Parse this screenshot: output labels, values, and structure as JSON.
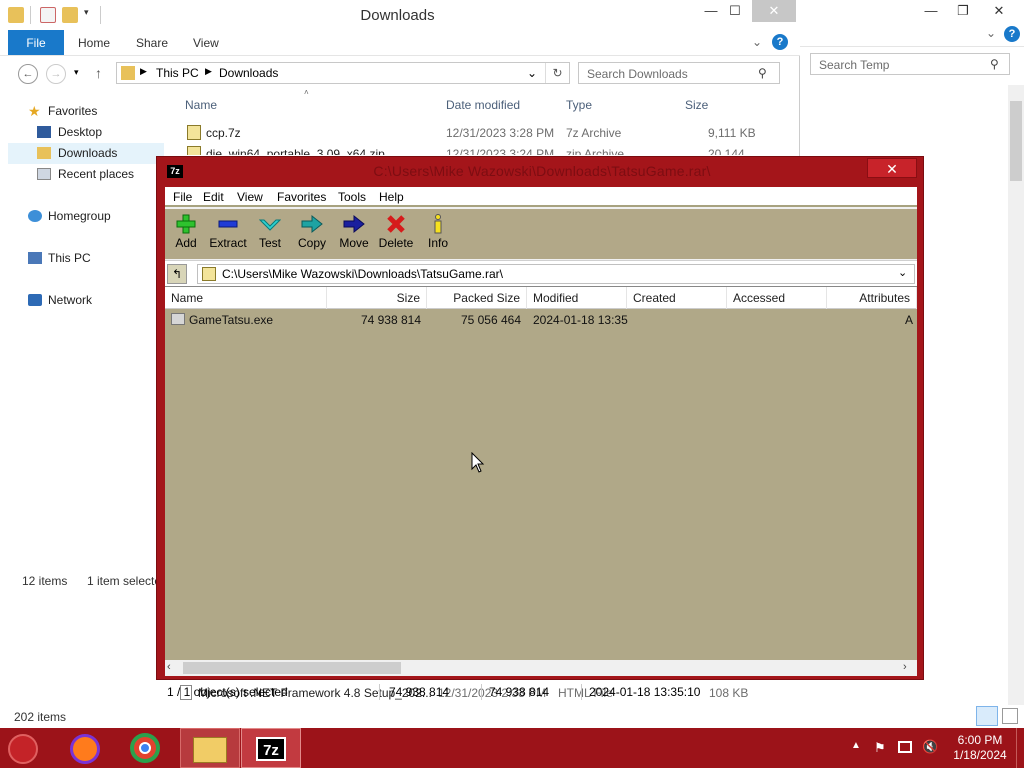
{
  "explorer": {
    "title": "Downloads",
    "ribbon_tabs": [
      "File",
      "Home",
      "Share",
      "View"
    ],
    "breadcrumb": [
      "This PC",
      "Downloads"
    ],
    "search_placeholder": "Search Downloads",
    "nav": {
      "favorites": "Favorites",
      "desktop": "Desktop",
      "downloads": "Downloads",
      "recent": "Recent places",
      "homegroup": "Homegroup",
      "thispc": "This PC",
      "network": "Network"
    },
    "columns": {
      "name": "Name",
      "date": "Date modified",
      "type": "Type",
      "size": "Size"
    },
    "files": [
      {
        "name": "ccp.7z",
        "date": "12/31/2023 3:28 PM",
        "type": "7z Archive",
        "size": "9,111 KB"
      },
      {
        "name": "die_win64_portable_3.09_x64.zip",
        "date": "12/31/2023 3:24 PM",
        "type": "zip Archive",
        "size": "20,144 KB"
      }
    ],
    "bottom_file": {
      "name": "Microsoft .NET Framework 4.8 Setup_202...",
      "date": "12/31/2023 2:33 PM",
      "type": "HTML File",
      "size": "108 KB"
    },
    "status_items": "12 items",
    "status_selected": "1 item selected",
    "bottom_status": "202 items"
  },
  "temp_window": {
    "search_placeholder": "Search Temp"
  },
  "zip": {
    "title": "C:\\Users\\Mike Wazowski\\Downloads\\TatsuGame.rar\\",
    "menu": [
      "File",
      "Edit",
      "View",
      "Favorites",
      "Tools",
      "Help"
    ],
    "toolbar": [
      "Add",
      "Extract",
      "Test",
      "Copy",
      "Move",
      "Delete",
      "Info"
    ],
    "path": "C:\\Users\\Mike Wazowski\\Downloads\\TatsuGame.rar\\",
    "columns": [
      "Name",
      "Size",
      "Packed Size",
      "Modified",
      "Created",
      "Accessed",
      "Attributes"
    ],
    "rows": [
      {
        "name": "GameTatsu.exe",
        "size": "74 938 814",
        "packed": "75 056 464",
        "modified": "2024-01-18 13:35",
        "created": "",
        "accessed": "",
        "attributes": "A"
      }
    ],
    "status": {
      "selected": "1 / 1 object(s) selected",
      "size": "74 938 814",
      "packed": "74 938 814",
      "modified": "2024-01-18 13:35:10"
    }
  },
  "taskbar": {
    "time": "6:00 PM",
    "date": "1/18/2024"
  }
}
